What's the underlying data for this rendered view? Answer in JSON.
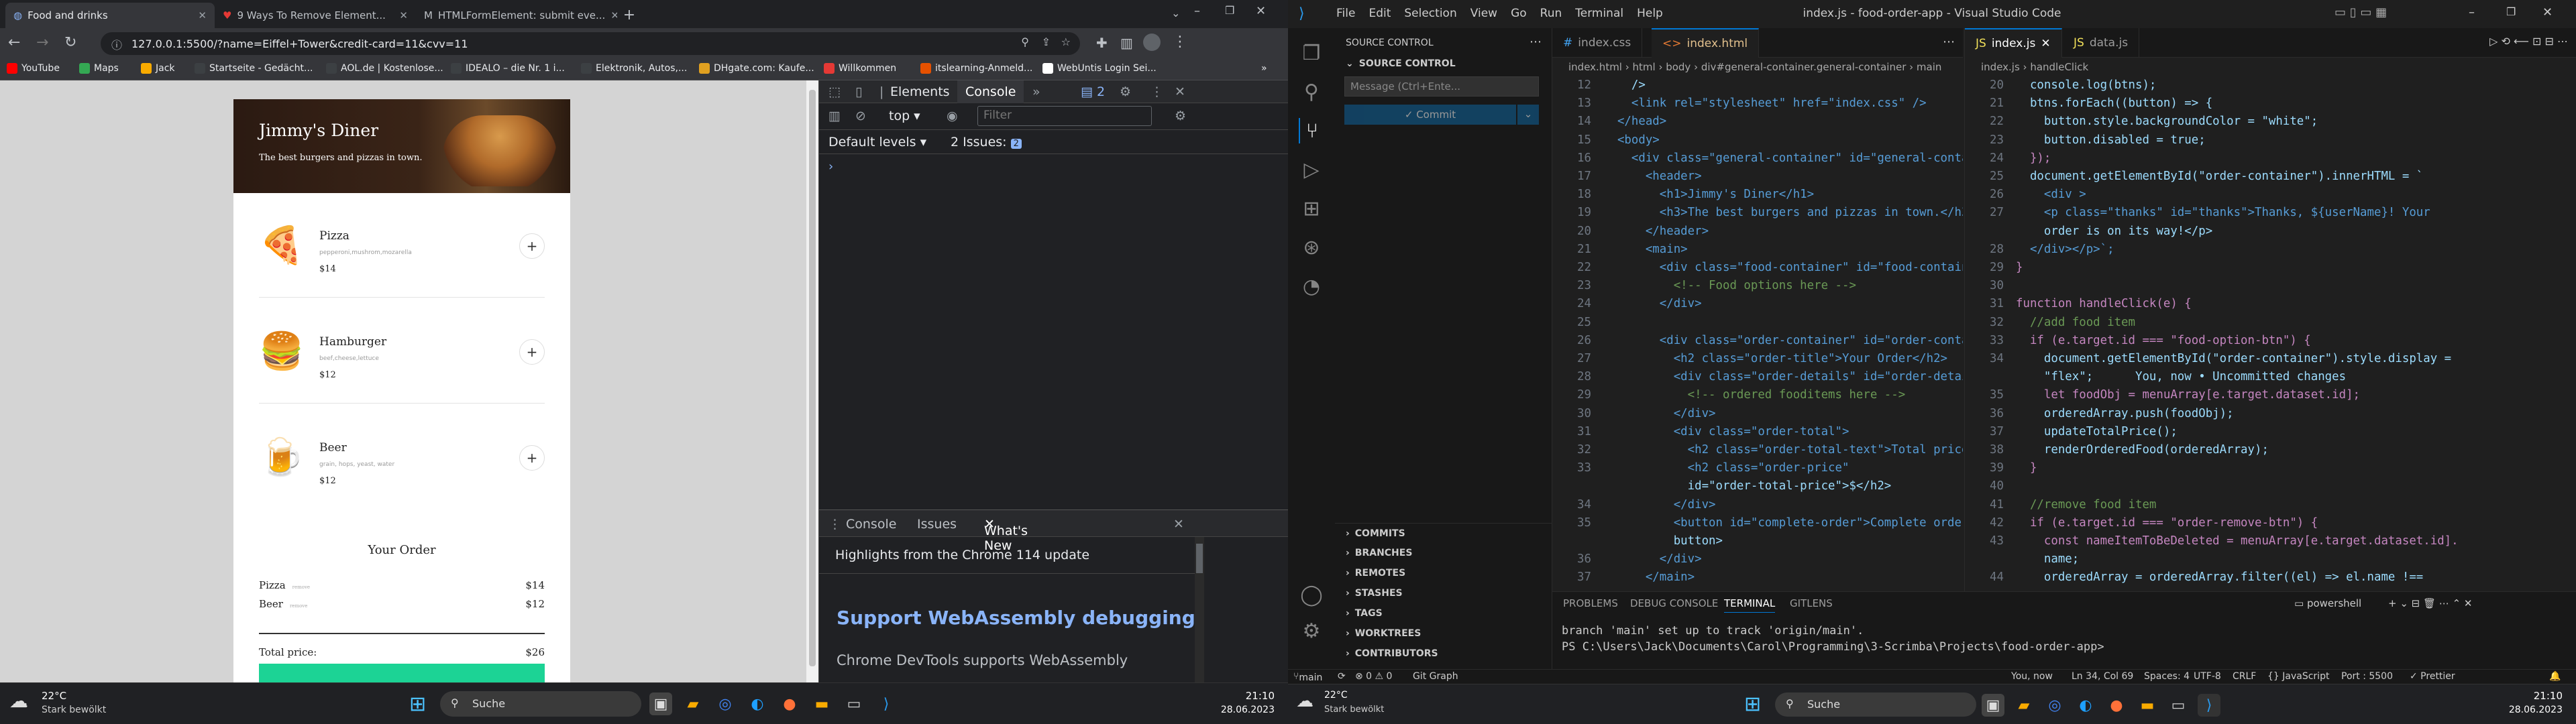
{
  "left": {
    "tabs": [
      {
        "title": "Food and drinks"
      },
      {
        "title": "9 Ways To Remove Element..."
      },
      {
        "title": "HTMLFormElement: submit eve..."
      }
    ],
    "url": "127.0.0.1:5500/?name=Eiffel+Tower&credit-card=11&cvv=11",
    "bookmarks": [
      "YouTube",
      "Maps",
      "Jack",
      "Startseite - Gedächt...",
      "AOL.de | Kostenlose...",
      "IDEALO – die Nr. 1 i...",
      "Elektronik, Autos,...",
      "DHgate.com: Kaufe...",
      "Willkommen",
      "itslearning-Anmeld...",
      "WebUntis Login Sei..."
    ],
    "diner": {
      "title": "Jimmy's Diner",
      "subtitle": "The best burgers and pizzas in town.",
      "items": [
        {
          "name": "Pizza",
          "ingredients": "pepperoni,mushrom,mozarella",
          "price": "$14",
          "emoji": "🍕"
        },
        {
          "name": "Hamburger",
          "ingredients": "beef,cheese,lettuce",
          "price": "$12",
          "emoji": "🍔"
        },
        {
          "name": "Beer",
          "ingredients": "grain, hops, yeast, water",
          "price": "$12",
          "emoji": "🍺"
        }
      ],
      "order_title": "Your Order",
      "order_rows": [
        {
          "name": "Pizza",
          "remove": "remove",
          "price": "$14"
        },
        {
          "name": "Beer",
          "remove": "remove",
          "price": "$12"
        }
      ],
      "total_label": "Total price:",
      "total_value": "$26"
    },
    "devtools": {
      "tabs": [
        "Elements",
        "Console"
      ],
      "issues_count": "2",
      "context": "top",
      "filter_placeholder": "Filter",
      "levels": "Default levels",
      "issues_label": "2 Issues:",
      "issues_badge": "2",
      "drawer_tabs": [
        "Console",
        "Issues",
        "What's New"
      ],
      "highlights": "Highlights from the Chrome 114 update",
      "headline": "Support WebAssembly debugging",
      "body": "Chrome DevTools supports WebAssembly"
    },
    "taskbar": {
      "temp": "22°C",
      "weather": "Stark bewölkt",
      "search": "Suche",
      "time": "21:10",
      "date": "28.06.2023"
    }
  },
  "right": {
    "title": "index.js - food-order-app - Visual Studio Code",
    "menu": [
      "File",
      "Edit",
      "Selection",
      "View",
      "Go",
      "Run",
      "Terminal",
      "Help"
    ],
    "scm_header": "SOURCE CONTROL",
    "scm_section": "SOURCE CONTROL",
    "commit_placeholder": "Message (Ctrl+Ente...",
    "commit_label": "✓ Commit",
    "sections": [
      "COMMITS",
      "BRANCHES",
      "REMOTES",
      "STASHES",
      "TAGS",
      "WORKTREES",
      "CONTRIBUTORS"
    ],
    "editor1": {
      "tabs": [
        "index.css",
        "index.html"
      ],
      "crumb": "index.html  ›  html  ›  body  ›  div#general-container.general-container  ›  main",
      "lines": [
        [
          "12",
          "    />"
        ],
        [
          "13",
          "    <link rel=\"stylesheet\" href=\"index.css\" />"
        ],
        [
          "14",
          "  </head>"
        ],
        [
          "15",
          "  <body>"
        ],
        [
          "16",
          "    <div class=\"general-container\" id=\"general-container\">"
        ],
        [
          "17",
          "      <header>"
        ],
        [
          "18",
          "        <h1>Jimmy's Diner</h1>"
        ],
        [
          "19",
          "        <h3>The best burgers and pizzas in town.</h3>"
        ],
        [
          "20",
          "      </header>"
        ],
        [
          "21",
          "      <main>"
        ],
        [
          "22",
          "        <div class=\"food-container\" id=\"food-container\">"
        ],
        [
          "23",
          "          <!-- Food options here -->"
        ],
        [
          "24",
          "        </div>"
        ],
        [
          "25",
          ""
        ],
        [
          "26",
          "        <div class=\"order-container\" id=\"order-container\">"
        ],
        [
          "27",
          "          <h2 class=\"order-title\">Your Order</h2>"
        ],
        [
          "28",
          "          <div class=\"order-details\" id=\"order-details\">"
        ],
        [
          "29",
          "            <!-- ordered fooditems here -->"
        ],
        [
          "30",
          "          </div>"
        ],
        [
          "31",
          "          <div class=\"order-total\">"
        ],
        [
          "32",
          "            <h2 class=\"order-total-text\">Total price:</h2>"
        ],
        [
          "33",
          "            <h2 class=\"order-price\""
        ],
        [
          "",
          "            id=\"order-total-price\">$</h2>"
        ],
        [
          "34",
          "          </div>"
        ],
        [
          "35",
          "          <button id=\"complete-order\">Complete order</"
        ],
        [
          "",
          "          button>"
        ],
        [
          "36",
          "        </div>"
        ],
        [
          "37",
          "      </main>"
        ]
      ]
    },
    "editor2": {
      "tabs": [
        "index.js",
        "data.js"
      ],
      "crumb": "index.js  ›  handleClick",
      "lines": [
        [
          "20",
          "  console.log(btns);"
        ],
        [
          "21",
          "  btns.forEach((button) => {"
        ],
        [
          "22",
          "    button.style.backgroundColor = \"white\";"
        ],
        [
          "23",
          "    button.disabled = true;"
        ],
        [
          "24",
          "  });"
        ],
        [
          "25",
          "  document.getElementById(\"order-container\").innerHTML = `"
        ],
        [
          "26",
          "    <div >"
        ],
        [
          "27",
          "    <p class=\"thanks\" id=\"thanks\">Thanks, ${userName}! Your"
        ],
        [
          "",
          "    order is on its way!</p>"
        ],
        [
          "28",
          "  </div></p>`;"
        ],
        [
          "29",
          "}"
        ],
        [
          "30",
          ""
        ],
        [
          "31",
          "function handleClick(e) {"
        ],
        [
          "32",
          "  //add food item"
        ],
        [
          "33",
          "  if (e.target.id === \"food-option-btn\") {"
        ],
        [
          "34",
          "    document.getElementById(\"order-container\").style.display ="
        ],
        [
          "",
          "    \"flex\";      You, now • Uncommitted changes"
        ],
        [
          "35",
          "    let foodObj = menuArray[e.target.dataset.id];"
        ],
        [
          "36",
          "    orderedArray.push(foodObj);"
        ],
        [
          "37",
          "    updateTotalPrice();"
        ],
        [
          "38",
          "    renderOrderedFood(orderedArray);"
        ],
        [
          "39",
          "  }"
        ],
        [
          "40",
          ""
        ],
        [
          "41",
          "  //remove food item"
        ],
        [
          "42",
          "  if (e.target.id === \"order-remove-btn\") {"
        ],
        [
          "43",
          "    const nameItemToBeDeleted = menuArray[e.target.dataset.id]."
        ],
        [
          "",
          "    name;"
        ],
        [
          "44",
          "    orderedArray = orderedArray.filter((el) => el.name !=="
        ]
      ]
    },
    "panel_tabs": [
      "PROBLEMS",
      "DEBUG CONSOLE",
      "TERMINAL",
      "GITLENS"
    ],
    "terminal_name": "powershell",
    "terminal_lines": [
      "branch 'main' set up to track 'origin/main'.",
      "PS C:\\Users\\Jack\\Documents\\Carol\\Programming\\3-Scrimba\\Projects\\food-order-app> "
    ],
    "status": {
      "branch": "main",
      "sync": "⟳",
      "errors": "⊗ 0 ⚠ 0",
      "graph": "Git Graph",
      "blame": "You, now",
      "pos": "Ln 34, Col 69",
      "spaces": "Spaces: 4",
      "enc": "UTF-8",
      "eol": "CRLF",
      "lang": "{} JavaScript",
      "port": "Port : 5500",
      "prettier": "✓ Prettier"
    },
    "taskbar": {
      "temp": "22°C",
      "weather": "Stark bewölkt",
      "search": "Suche",
      "time": "21:10",
      "date": "28.06.2023"
    }
  }
}
